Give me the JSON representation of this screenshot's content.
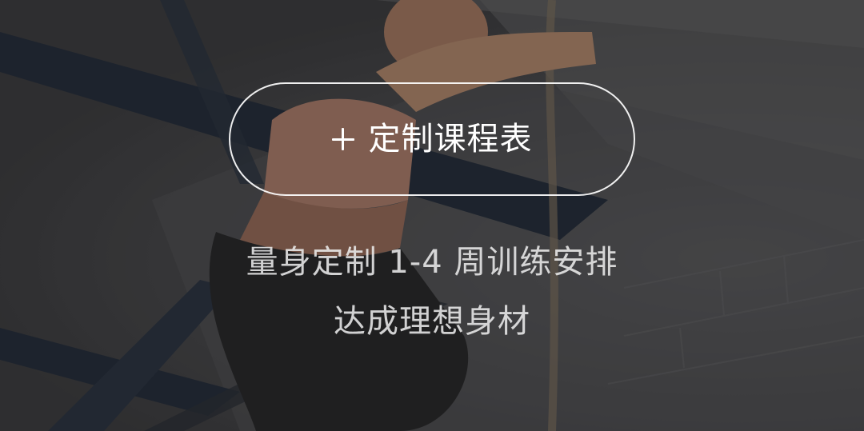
{
  "banner": {
    "cta": {
      "icon": "plus-icon",
      "label": "定制课程表"
    },
    "description": {
      "line1": "量身定制 1-4 周训练安排",
      "line2": "达成理想身材"
    }
  }
}
